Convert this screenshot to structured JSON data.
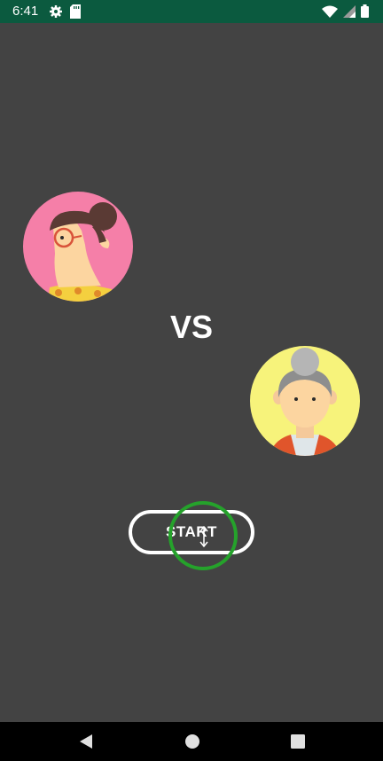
{
  "status_bar": {
    "time": "6:41",
    "left_icons": [
      "settings-icon",
      "sd-card-icon"
    ],
    "right_icons": [
      "wifi-icon",
      "signal-icon",
      "battery-icon"
    ],
    "background": "#0b5a3f"
  },
  "main": {
    "player_one_avatar": "woman-with-glasses-avatar",
    "player_two_avatar": "grandma-avatar",
    "vs_label": "VS",
    "start_label": "START",
    "background": "#434343",
    "accent_touch_color": "#25a22b"
  },
  "nav_bar": {
    "buttons": [
      "back-icon",
      "home-icon",
      "recents-icon"
    ]
  }
}
